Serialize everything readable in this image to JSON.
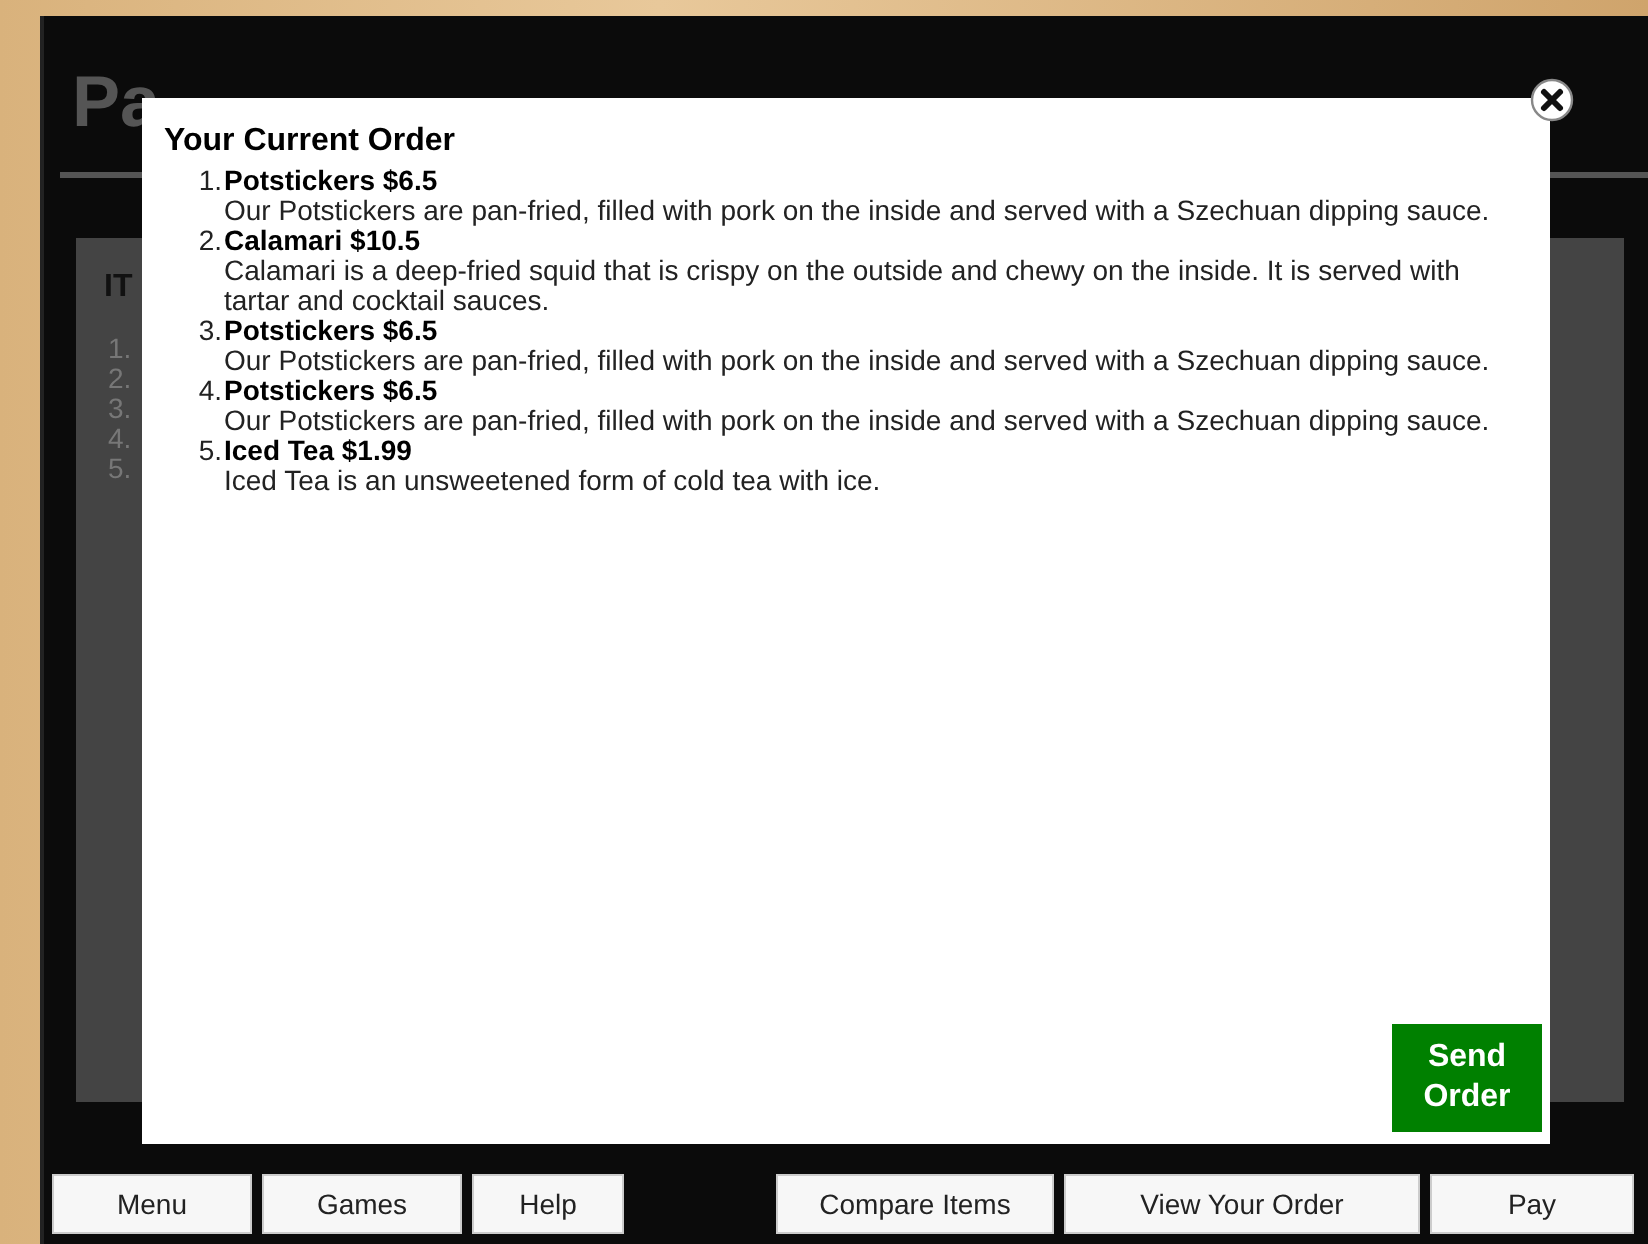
{
  "page": {
    "heading": "Pa",
    "panel_heading": "IT",
    "panel_numbers": [
      "1.",
      "2.",
      "3.",
      "4.",
      "5."
    ]
  },
  "modal": {
    "title": "Your Current Order",
    "items": [
      {
        "number": "1.",
        "name": "Potstickers $6.5",
        "description": "Our Potstickers are pan-fried, filled with pork on the inside and served with a Szechuan dipping sauce."
      },
      {
        "number": "2.",
        "name": "Calamari $10.5",
        "description": "Calamari is a deep-fried squid that is crispy on the outside and chewy on the inside. It is served with tartar and cocktail sauces."
      },
      {
        "number": "3.",
        "name": "Potstickers $6.5",
        "description": "Our Potstickers are pan-fried, filled with pork on the inside and served with a Szechuan dipping sauce."
      },
      {
        "number": "4.",
        "name": "Potstickers $6.5",
        "description": "Our Potstickers are pan-fried, filled with pork on the inside and served with a Szechuan dipping sauce."
      },
      {
        "number": "5.",
        "name": "Iced Tea $1.99",
        "description": "Iced Tea is an unsweetened form of cold tea with ice."
      }
    ],
    "send_button": "Send Order"
  },
  "nav": [
    "Menu",
    "Games",
    "Help",
    "Compare Items",
    "View Your Order",
    "Pay"
  ]
}
